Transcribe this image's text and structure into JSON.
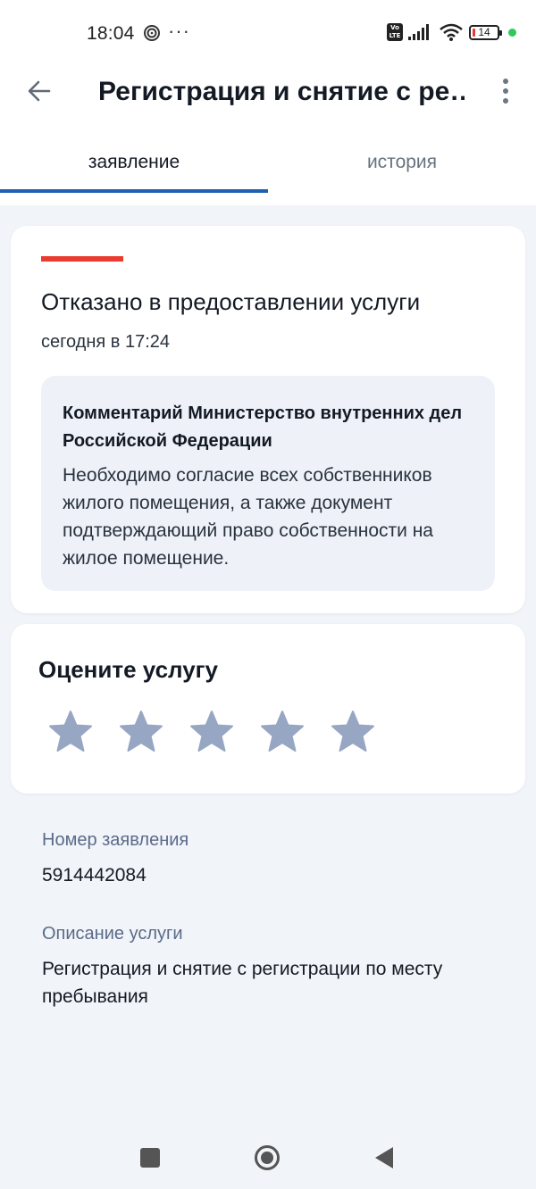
{
  "status_bar": {
    "time": "18:04",
    "dots": "···",
    "volte": "Vo LTE",
    "battery_level": "14"
  },
  "appbar": {
    "title": "Регистрация и снятие с ре…",
    "back_icon": "arrow-left-icon",
    "more_icon": "more-vertical-icon"
  },
  "tabs": [
    {
      "label": "заявление",
      "selected": true
    },
    {
      "label": "история",
      "selected": false
    }
  ],
  "status_card": {
    "title": "Отказано в предоставлении услуги",
    "time": "сегодня в 17:24",
    "accent_color": "#ea3b2e",
    "comment": {
      "title": "Комментарий Министерство внутренних дел Российской Федерации",
      "text": "Необходимо согласие всех собственников жилого помещения, а также документ подтверждающий право собственности на жилое помещение."
    }
  },
  "rating": {
    "title": "Оцените услугу",
    "max_stars": 5,
    "selected_stars": 0,
    "star_color": "#97a6c2"
  },
  "details": {
    "application_number_label": "Номер заявления",
    "application_number": "5914442084",
    "service_description_label": "Описание услуги",
    "service_description": "Регистрация и снятие с регистрации по месту пребывания"
  },
  "colors": {
    "tab_indicator": "#1e5fb4",
    "secondary_label": "#5a6b8a",
    "background": "#f1f4f8"
  }
}
